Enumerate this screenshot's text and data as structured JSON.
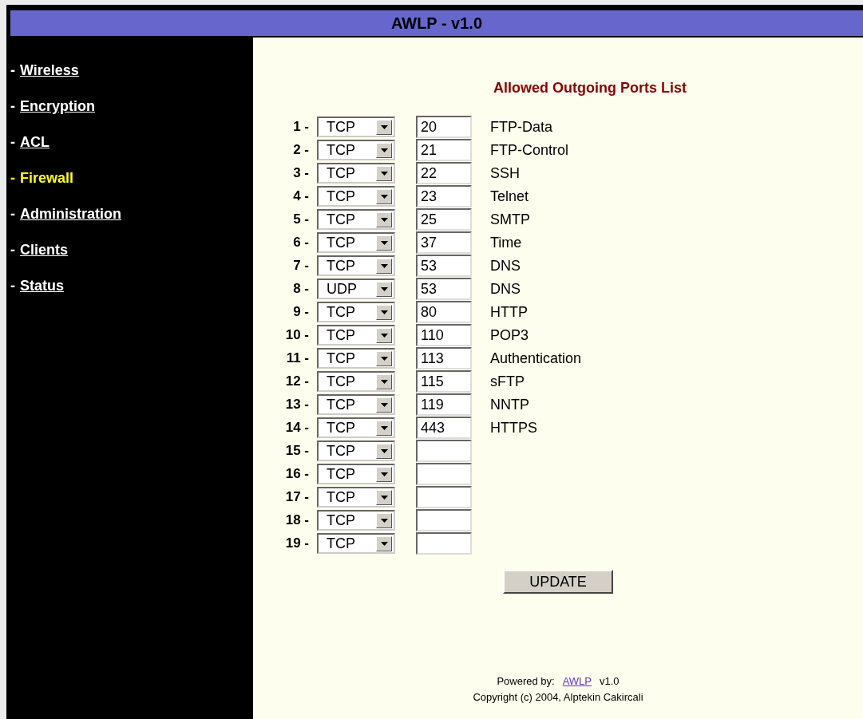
{
  "header": {
    "title": "AWLP - v1.0"
  },
  "sidebar": {
    "items": [
      {
        "marker": "-",
        "label": "Wireless",
        "selected": false
      },
      {
        "marker": "-",
        "label": "Encryption",
        "selected": false
      },
      {
        "marker": "-",
        "label": "ACL",
        "selected": false
      },
      {
        "marker": "-",
        "label": "Firewall",
        "selected": true
      },
      {
        "marker": "-",
        "label": "Administration",
        "selected": false
      },
      {
        "marker": "-",
        "label": "Clients",
        "selected": false
      },
      {
        "marker": "-",
        "label": "Status",
        "selected": false
      }
    ]
  },
  "content": {
    "title": "Allowed Outgoing Ports List",
    "rows": [
      {
        "number": "1 -",
        "protocol": "TCP",
        "port": "20",
        "service": "FTP-Data"
      },
      {
        "number": "2 -",
        "protocol": "TCP",
        "port": "21",
        "service": "FTP-Control"
      },
      {
        "number": "3 -",
        "protocol": "TCP",
        "port": "22",
        "service": "SSH"
      },
      {
        "number": "4 -",
        "protocol": "TCP",
        "port": "23",
        "service": "Telnet"
      },
      {
        "number": "5 -",
        "protocol": "TCP",
        "port": "25",
        "service": "SMTP"
      },
      {
        "number": "6 -",
        "protocol": "TCP",
        "port": "37",
        "service": "Time"
      },
      {
        "number": "7 -",
        "protocol": "TCP",
        "port": "53",
        "service": "DNS"
      },
      {
        "number": "8 -",
        "protocol": "UDP",
        "port": "53",
        "service": "DNS"
      },
      {
        "number": "9 -",
        "protocol": "TCP",
        "port": "80",
        "service": "HTTP"
      },
      {
        "number": "10 -",
        "protocol": "TCP",
        "port": "110",
        "service": "POP3"
      },
      {
        "number": "11 -",
        "protocol": "TCP",
        "port": "113",
        "service": "Authentication"
      },
      {
        "number": "12 -",
        "protocol": "TCP",
        "port": "115",
        "service": "sFTP"
      },
      {
        "number": "13 -",
        "protocol": "TCP",
        "port": "119",
        "service": "NNTP"
      },
      {
        "number": "14 -",
        "protocol": "TCP",
        "port": "443",
        "service": "HTTPS"
      },
      {
        "number": "15 -",
        "protocol": "TCP"
      },
      {
        "number": "16 -",
        "protocol": "TCP"
      },
      {
        "number": "17 -",
        "protocol": "TCP"
      },
      {
        "number": "18 -",
        "protocol": "TCP"
      },
      {
        "number": "19 -",
        "protocol": "TCP"
      }
    ],
    "button": "UPDATE"
  },
  "footer": {
    "powered_by": "Powered by:",
    "link": "AWLP",
    "version": "v1.0",
    "copyright": "Copyright (c) 2004, Alptekin Cakircali"
  }
}
